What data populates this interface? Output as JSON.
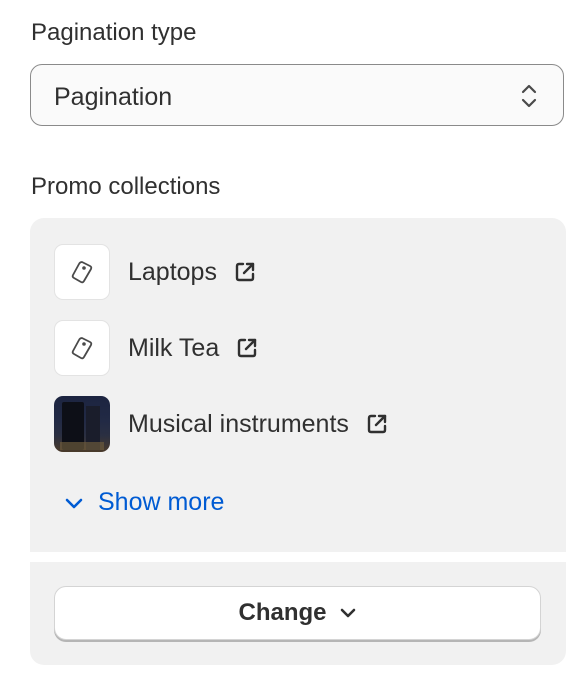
{
  "pagination": {
    "label": "Pagination type",
    "selected": "Pagination",
    "arrows_icon": "select-arrows-icon"
  },
  "promo": {
    "label": "Promo collections",
    "items": [
      {
        "label": "Laptops",
        "thumb": "tag-icon"
      },
      {
        "label": "Milk Tea",
        "thumb": "tag-icon"
      },
      {
        "label": "Musical instruments",
        "thumb": "image"
      }
    ],
    "show_more": "Show more",
    "change": "Change"
  },
  "colors": {
    "link": "#005bd3",
    "text": "#303030",
    "card_bg": "#f1f1f1"
  }
}
